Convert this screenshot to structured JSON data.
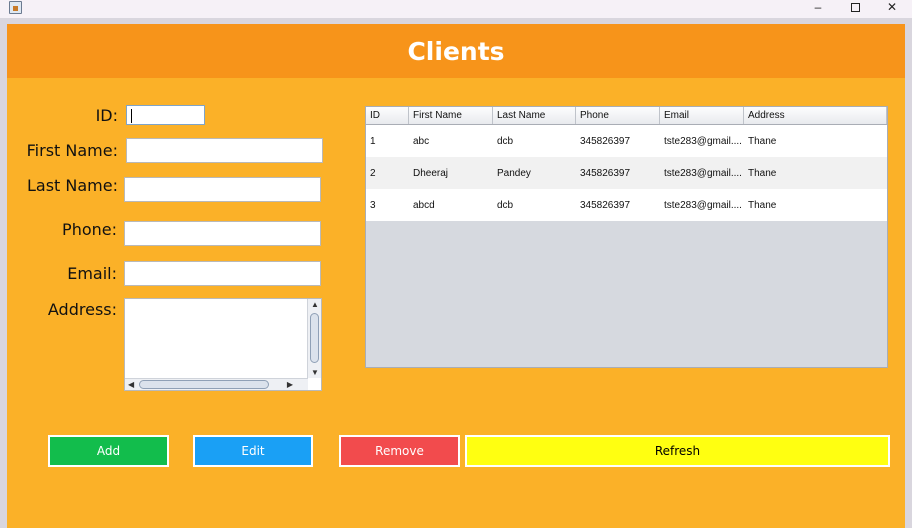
{
  "window": {
    "minimize": "–",
    "maximize": "",
    "close": "✕"
  },
  "header": {
    "title": "Clients"
  },
  "form": {
    "id_label": "ID:",
    "first_name_label": "First Name:",
    "last_name_label": "Last Name:",
    "phone_label": "Phone:",
    "email_label": "Email:",
    "address_label": "Address:",
    "id_value": "",
    "first_name_value": "",
    "last_name_value": "",
    "phone_value": "",
    "email_value": "",
    "address_value": ""
  },
  "table": {
    "columns": [
      "ID",
      "First Name",
      "Last Name",
      "Phone",
      "Email",
      "Address"
    ],
    "rows": [
      [
        "1",
        "abc",
        "dcb",
        "345826397",
        "tste283@gmail....",
        "Thane"
      ],
      [
        "2",
        "Dheeraj",
        "Pandey",
        "345826397",
        "tste283@gmail....",
        "Thane"
      ],
      [
        "3",
        "abcd",
        "dcb",
        "345826397",
        "tste283@gmail....",
        "Thane"
      ]
    ]
  },
  "buttons": {
    "add": "Add",
    "edit": "Edit",
    "remove": "Remove",
    "refresh": "Refresh"
  },
  "colors": {
    "header": "#f7941a",
    "background": "#fbb128",
    "add": "#12bd4c",
    "edit": "#1aa0f5",
    "remove": "#f24b4d",
    "refresh": "#ffff11",
    "row_alt": "#f1f1f1"
  }
}
